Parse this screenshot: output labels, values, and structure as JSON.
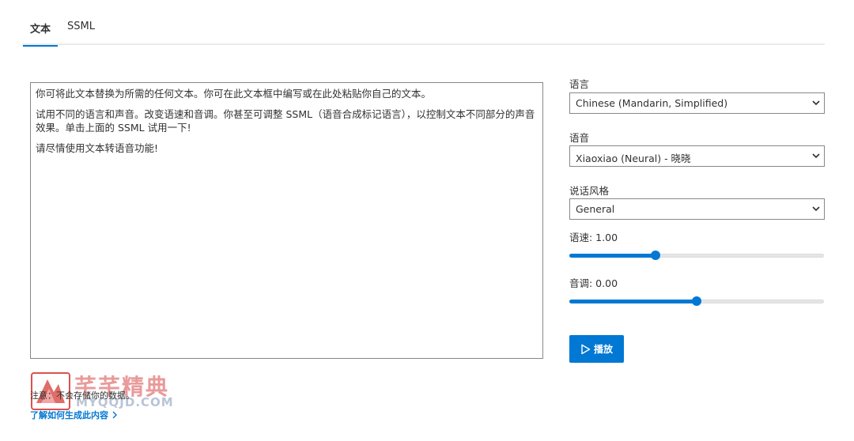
{
  "tabs": [
    {
      "label": "文本",
      "active": true
    },
    {
      "label": "SSML",
      "active": false
    }
  ],
  "editor": {
    "paragraphs": [
      "你可将此文本替换为所需的任何文本。你可在此文本框中编写或在此处粘贴你自己的文本。",
      "试用不同的语言和声音。改变语速和音调。你甚至可调整 SSML（语音合成标记语言），以控制文本不同部分的声音效果。单击上面的 SSML 试用一下!",
      "请尽情使用文本转语音功能!"
    ]
  },
  "language": {
    "label": "语言",
    "value": "Chinese (Mandarin, Simplified)"
  },
  "voice": {
    "label": "语音",
    "value": "Xiaoxiao (Neural) - 晓晓"
  },
  "style": {
    "label": "说话风格",
    "value": "General"
  },
  "rate": {
    "label": "语速: 1.00",
    "value": 1.0,
    "fraction": 0.34
  },
  "pitch": {
    "label": "音调: 0.00",
    "value": 0.0,
    "fraction": 0.5
  },
  "play_button": {
    "label": "播放",
    "icon": "play-icon"
  },
  "watermark": {
    "title": "芊芊精典",
    "subtitle": "MYQQJD.COM"
  },
  "note": "注意：不会存储你的数据。",
  "learn_link": "了解如何生成此内容",
  "colors": {
    "accent": "#0078d4"
  }
}
